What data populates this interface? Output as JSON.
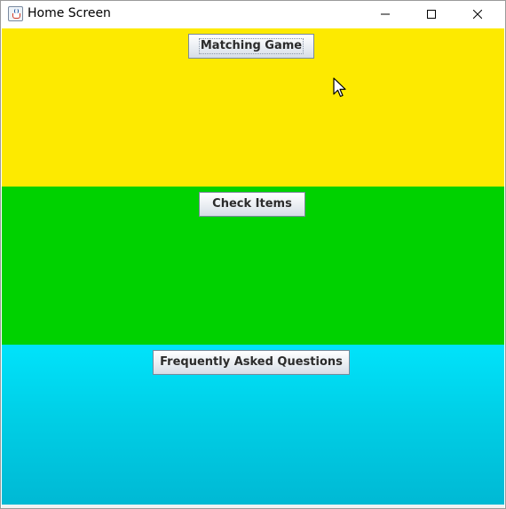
{
  "window": {
    "title": "Home Screen",
    "icon": "java-cup-icon",
    "controls": [
      "minimize-icon",
      "maximize-icon",
      "close-icon"
    ]
  },
  "panels": [
    {
      "color": "#fdea00",
      "button_label": "Matching Game",
      "focused": true
    },
    {
      "color": "#00d200",
      "button_label": "Check Items",
      "focused": false
    },
    {
      "color": "#00e3fb",
      "button_label": "Frequently Asked Questions",
      "focused": false
    }
  ],
  "cursor": {
    "icon": "mouse-pointer-icon"
  }
}
